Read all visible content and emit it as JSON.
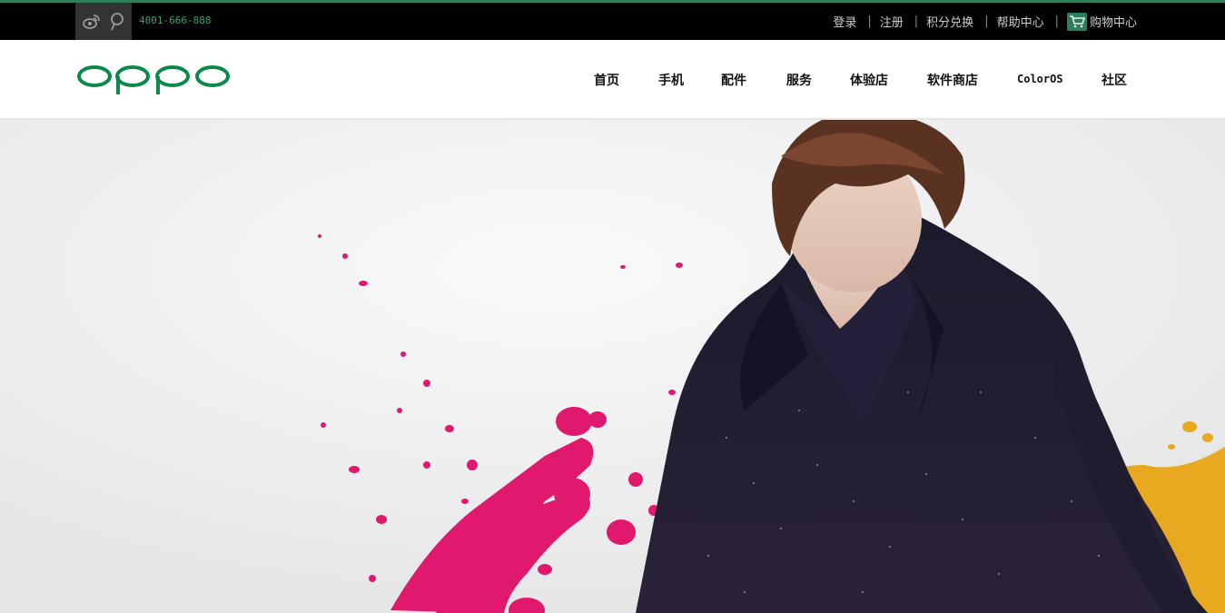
{
  "topbar": {
    "social": [
      {
        "icon": "weibo-icon"
      },
      {
        "icon": "pin-icon"
      }
    ],
    "phone": "4001-666-888",
    "account": {
      "login": "登录",
      "register": "注册",
      "points": "积分兑换",
      "help": "帮助中心",
      "cart": "购物中心"
    }
  },
  "header": {
    "logo_text": "oppo",
    "nav": [
      "首页",
      "手机",
      "配件",
      "服务",
      "体验店",
      "软件商店",
      "ColorOS",
      "社区"
    ]
  },
  "colors": {
    "brand_green": "#0a8a4a",
    "accent_pink": "#e0186e",
    "accent_yellow": "#e8a820"
  }
}
